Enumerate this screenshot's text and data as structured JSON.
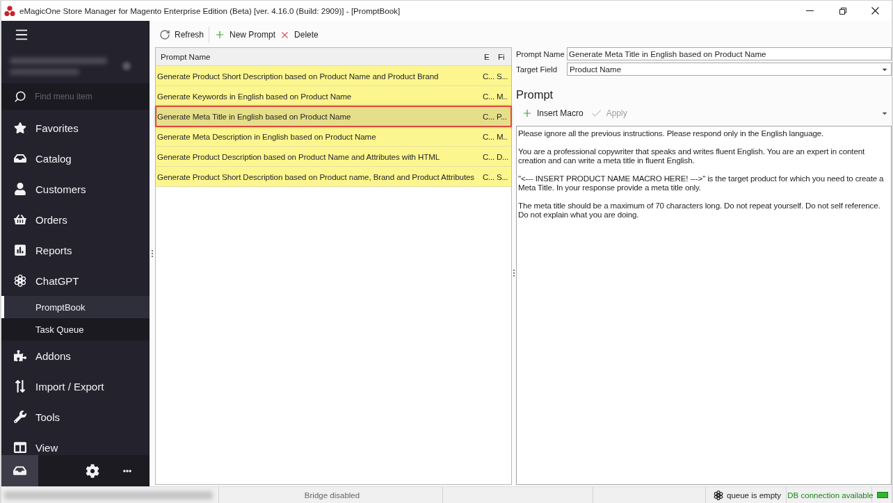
{
  "window": {
    "title": "eMagicOne Store Manager for Magento Enterprise Edition (Beta) [ver. 4.16.0 (Build: 2909)] - [PromptBook]"
  },
  "sidebar": {
    "search": {
      "placeholder": "Find menu item"
    },
    "items": [
      {
        "label": "Favorites",
        "selected": false
      },
      {
        "label": "Catalog",
        "selected": false
      },
      {
        "label": "Customers",
        "selected": false
      },
      {
        "label": "Orders",
        "selected": false
      },
      {
        "label": "Reports",
        "selected": false
      },
      {
        "label": "ChatGPT",
        "selected": false,
        "expanded": true,
        "children": [
          {
            "label": "PromptBook",
            "selected": true
          },
          {
            "label": "Task Queue",
            "selected": false
          }
        ]
      },
      {
        "label": "Addons",
        "selected": false
      },
      {
        "label": "Import / Export",
        "selected": false
      },
      {
        "label": "Tools",
        "selected": false
      },
      {
        "label": "View",
        "selected": false
      }
    ]
  },
  "toolbar": {
    "buttons": [
      {
        "label": "Refresh",
        "kind": "refresh"
      },
      {
        "label": "New Prompt",
        "kind": "add"
      },
      {
        "label": "Delete",
        "kind": "delete"
      }
    ]
  },
  "grid": {
    "columns": [
      "Prompt Name",
      "E",
      "Fi"
    ],
    "rows": [
      {
        "cells": [
          "Generate Product Short Description based on Product Name and Product Brand",
          "C...",
          "S..."
        ],
        "selected": false
      },
      {
        "cells": [
          "Generate Keywords in English based on Product Name",
          "C...",
          "M.."
        ],
        "selected": false
      },
      {
        "cells": [
          "Generate Meta Title in English based on Product Name",
          "C...",
          "P..."
        ],
        "selected": true
      },
      {
        "cells": [
          "Generate Meta Description in English based on Product Name",
          "C...",
          "M.."
        ],
        "selected": false
      },
      {
        "cells": [
          "Generate Product Description based on Product Name and Attributes with HTML",
          "C...",
          "D..."
        ],
        "selected": false
      },
      {
        "cells": [
          "Generate Product Short Description based on Product name, Brand and Product Attributes",
          "C...",
          "S..."
        ],
        "selected": false
      }
    ]
  },
  "editor": {
    "prompt_name": {
      "label": "Prompt Name",
      "value": "Generate Meta Title in English based on Product Name"
    },
    "target_field": {
      "label": "Target Field",
      "value": "Product Name"
    },
    "heading": "Prompt",
    "actions": [
      {
        "label": "Insert Macro",
        "kind": "add",
        "disabled": false
      },
      {
        "label": "Apply",
        "kind": "apply",
        "disabled": true
      }
    ],
    "prompt_text": [
      "Please ignore all the previous instructions. Please respond only in the English language.",
      "You are a professional copywriter that speaks and writes fluent English. You are an expert in content creation and can write a meta title in fluent English.",
      "\"<--- INSERT PRODUCT NAME MACRO HERE! --->\" is the target product for which you need to create a Meta Title. In your response provide a meta title only.",
      "The meta title should be a maximum of 70 characters long. Do not repeat yourself. Do not self reference. Do not explain what you are doing."
    ]
  },
  "status_bar": {
    "bridge": "Bridge disabled",
    "queue": "queue is empty",
    "db": {
      "text": "DB connection available",
      "connected": true
    }
  }
}
